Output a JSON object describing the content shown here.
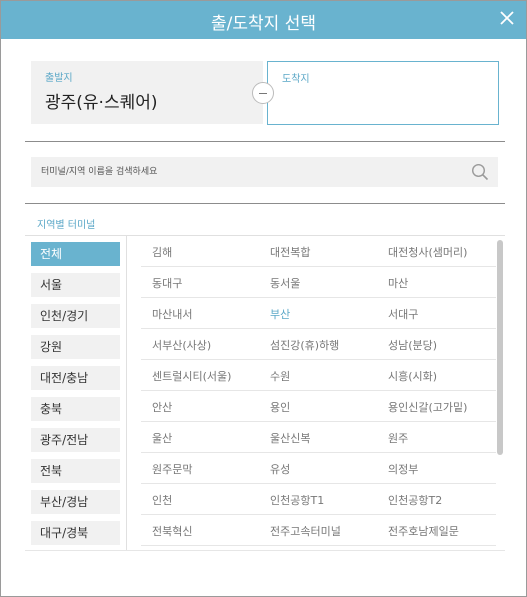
{
  "dialog": {
    "title": "출/도착지 선택",
    "close_icon": "close-icon"
  },
  "departure": {
    "label": "출발지",
    "value": "광주(유·스퀘어)"
  },
  "arrival": {
    "label": "도착지",
    "value": ""
  },
  "swap_icon": "swap-icon",
  "search": {
    "placeholder": "터미널/지역 이름을 검색하세요",
    "icon": "search-icon"
  },
  "section_label": "지역별 터미널",
  "regions": [
    {
      "label": "전체",
      "active": true
    },
    {
      "label": "서울",
      "active": false
    },
    {
      "label": "인천/경기",
      "active": false
    },
    {
      "label": "강원",
      "active": false
    },
    {
      "label": "대전/충남",
      "active": false
    },
    {
      "label": "충북",
      "active": false
    },
    {
      "label": "광주/전남",
      "active": false
    },
    {
      "label": "전북",
      "active": false
    },
    {
      "label": "부산/경남",
      "active": false
    },
    {
      "label": "대구/경북",
      "active": false
    }
  ],
  "terminals": [
    [
      "김해",
      "대전복합",
      "대전청사(샘머리)"
    ],
    [
      "동대구",
      "동서울",
      "마산"
    ],
    [
      "마산내서",
      "부산",
      "서대구"
    ],
    [
      "서부산(사상)",
      "섬진강(휴)하행",
      "성남(분당)"
    ],
    [
      "센트럴시티(서울)",
      "수원",
      "시흥(시화)"
    ],
    [
      "안산",
      "용인",
      "용인신갈(고가밑)"
    ],
    [
      "울산",
      "울산신복",
      "원주"
    ],
    [
      "원주문막",
      "유성",
      "의정부"
    ],
    [
      "인천",
      "인천공항T1",
      "인천공항T2"
    ],
    [
      "전북혁신",
      "전주고속터미널",
      "전주호남제일문"
    ],
    [
      "",
      "",
      ""
    ]
  ],
  "selected_terminal": "부산",
  "colors": {
    "accent": "#69b3cf",
    "accent_text": "#5aa7c7",
    "panel_bg": "#f1f1f1"
  }
}
